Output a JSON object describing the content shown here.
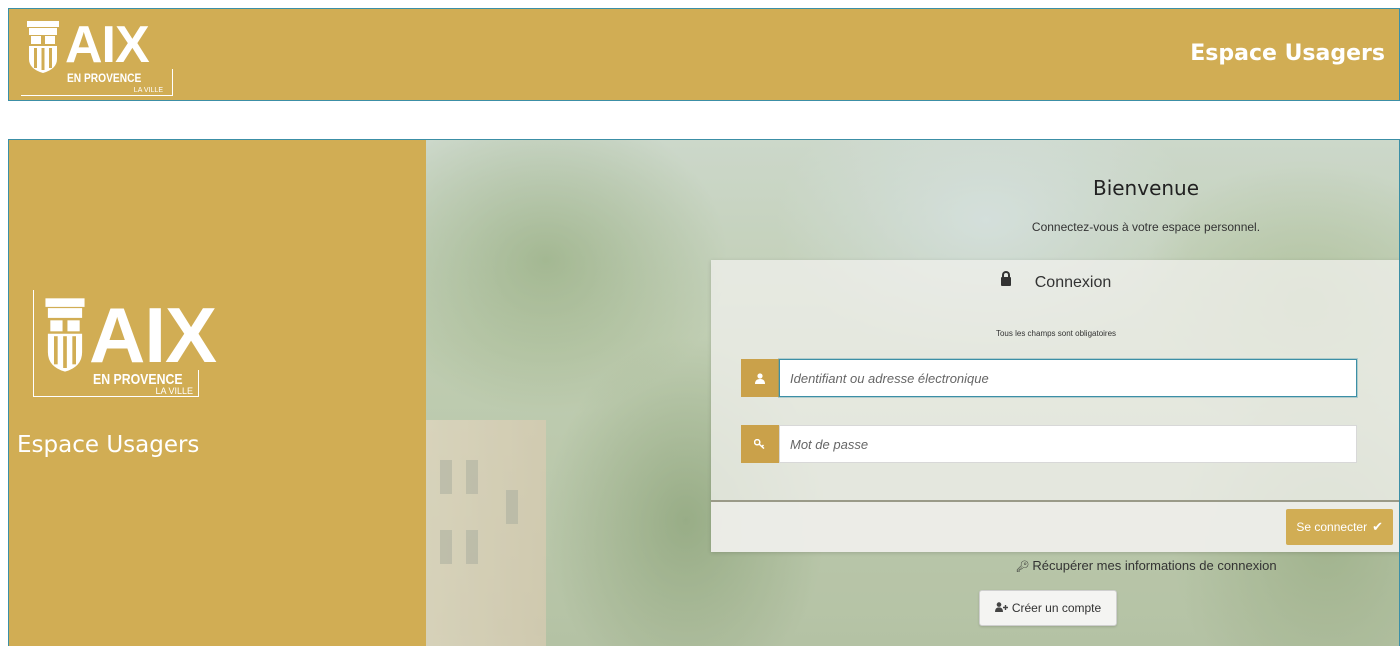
{
  "header": {
    "logo": {
      "aix": "AIX",
      "en_provence": "EN PROVENCE",
      "la_ville": "LA VILLE"
    },
    "title": "Espace Usagers"
  },
  "sidebar": {
    "logo": {
      "aix": "AIX",
      "en_provence": "EN PROVENCE",
      "la_ville": "LA VILLE"
    },
    "title": "Espace Usagers"
  },
  "welcome": {
    "title": "Bienvenue",
    "subtitle": "Connectez-vous à votre espace personnel."
  },
  "login": {
    "heading": "Connexion",
    "required_note": "Tous les champs sont obligatoires",
    "username": {
      "placeholder": "Identifiant ou adresse électronique",
      "icon": "user-icon"
    },
    "password": {
      "placeholder": "Mot de passe",
      "icon": "key-icon"
    },
    "submit_label": "Se connecter",
    "submit_icon": "check-icon"
  },
  "recover_link": "Récupérer mes informations de connexion",
  "create_account_label": "Créer un compte",
  "colors": {
    "brand_gold": "#d1ad54",
    "accent_border": "#3c8fa6"
  }
}
